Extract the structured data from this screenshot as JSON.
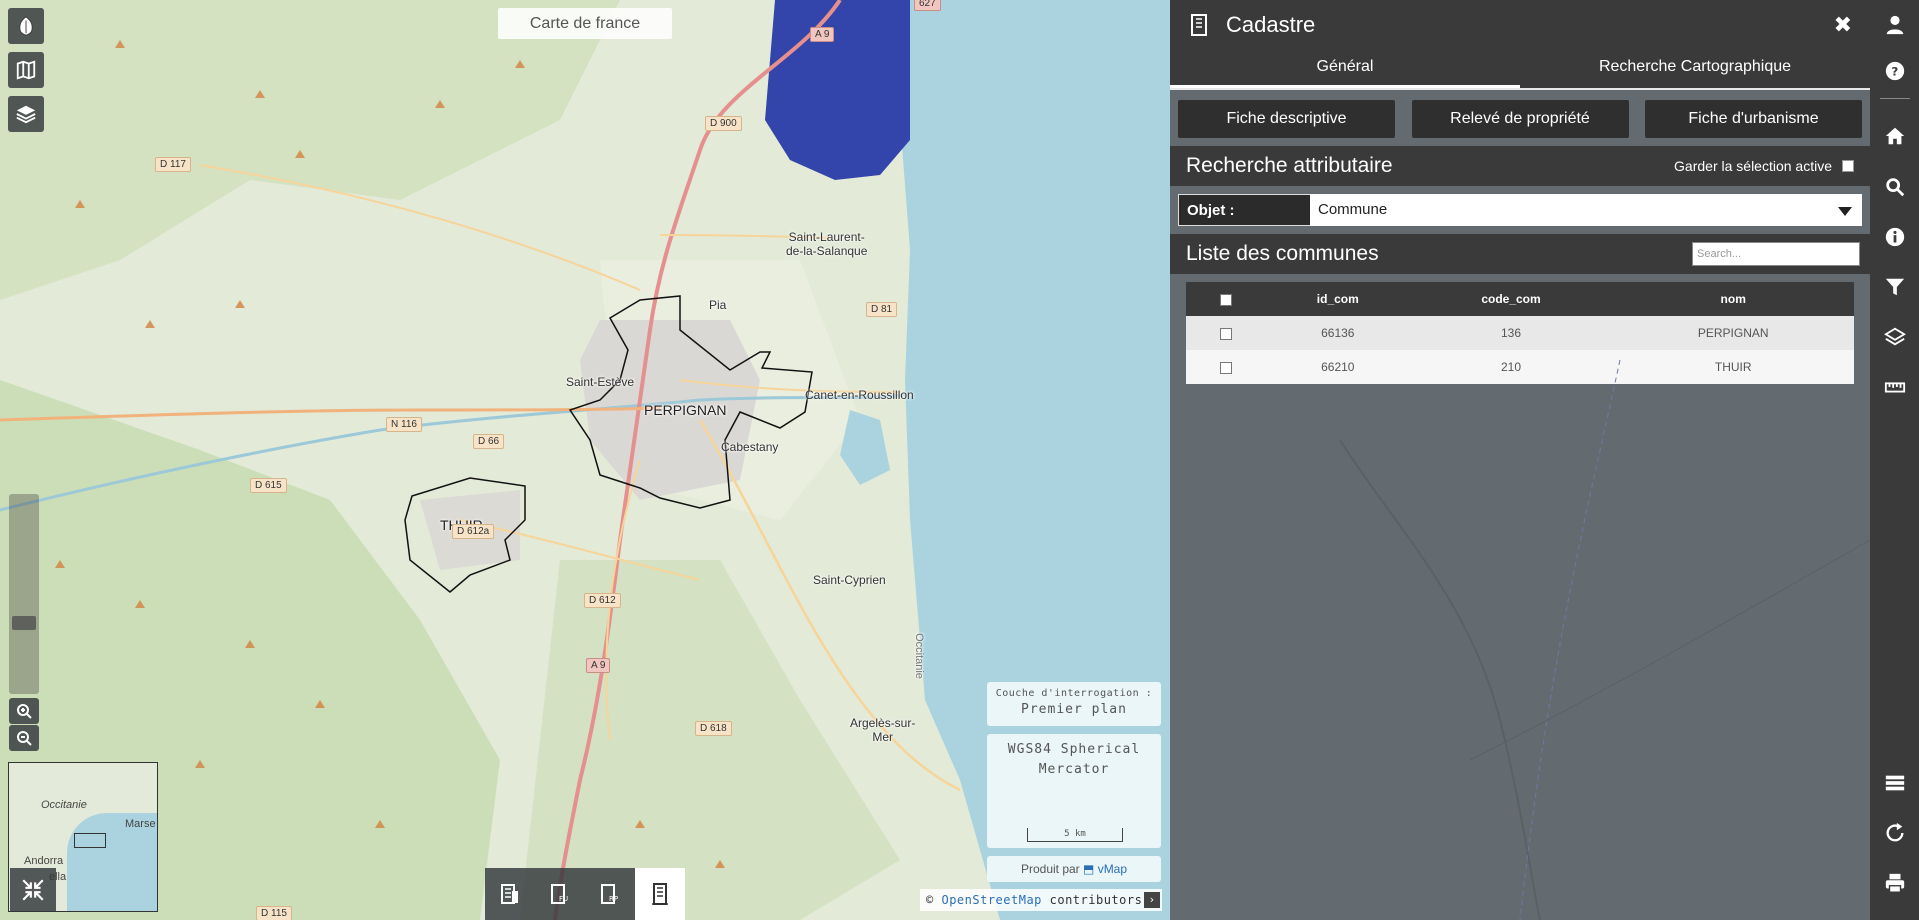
{
  "map": {
    "title": "Carte de france",
    "places": {
      "perpignan": "PERPIGNAN",
      "thuir": "THUIR",
      "saint_esteve": "Saint-Estève",
      "canet": "Canet-en-Roussillon",
      "cabestany": "Cabestany",
      "pia": "Pia",
      "saint_laurent": "Saint-Laurent-\nde-la-Salanque",
      "saint_cyprien": "Saint-Cyprien",
      "argeles": "Argelès-sur-\nMer",
      "occitanie": "Occitanie"
    },
    "roads": {
      "a9_top": "A 9",
      "d900": "D 900",
      "d117": "D 117",
      "d81": "D 81",
      "n116": "N 116",
      "d66": "D 66",
      "d615": "D 615",
      "d612a": "D 612a",
      "d612": "D 612",
      "a9_bottom": "A 9",
      "d618": "D 618",
      "d115": "D 115",
      "e627": "627"
    },
    "overview": {
      "region": "Occitanie",
      "andorra": "Andorra",
      "ella": "ella",
      "marseille": "Marse"
    },
    "query_layer": {
      "label": "Couche d'interrogation :",
      "value": "Premier plan"
    },
    "projection": {
      "line1": "WGS84 Spherical",
      "line2": "Mercator",
      "scale": "5 km"
    },
    "credit": {
      "prefix": "Produit par",
      "brand": "vMap"
    },
    "attribution": {
      "prefix": "©",
      "link": "OpenStreetMap",
      "suffix": "contributors.",
      "toggle": "›"
    }
  },
  "panel": {
    "title": "Cadastre",
    "close": "✖",
    "tabs": [
      "Général",
      "Recherche Cartographique"
    ],
    "actions": [
      "Fiche descriptive",
      "Relevé de propriété",
      "Fiche d'urbanisme"
    ],
    "search_section": {
      "title": "Recherche attributaire",
      "keep_selection": "Garder la sélection active"
    },
    "object": {
      "label": "Objet :",
      "value": "Commune"
    },
    "list": {
      "title": "Liste des communes",
      "search_placeholder": "Search..."
    },
    "table": {
      "columns": [
        "id_com",
        "code_com",
        "nom"
      ],
      "rows": [
        {
          "id_com": "66136",
          "code_com": "136",
          "nom": "PERPIGNAN"
        },
        {
          "id_com": "66210",
          "code_com": "210",
          "nom": "THUIR"
        }
      ]
    }
  },
  "colors": {
    "panel_bg": "#646b70",
    "header_bg": "#3a3a3a",
    "sea": "#aad3df",
    "lake": "#3344aa",
    "link": "#2a6fb5"
  }
}
